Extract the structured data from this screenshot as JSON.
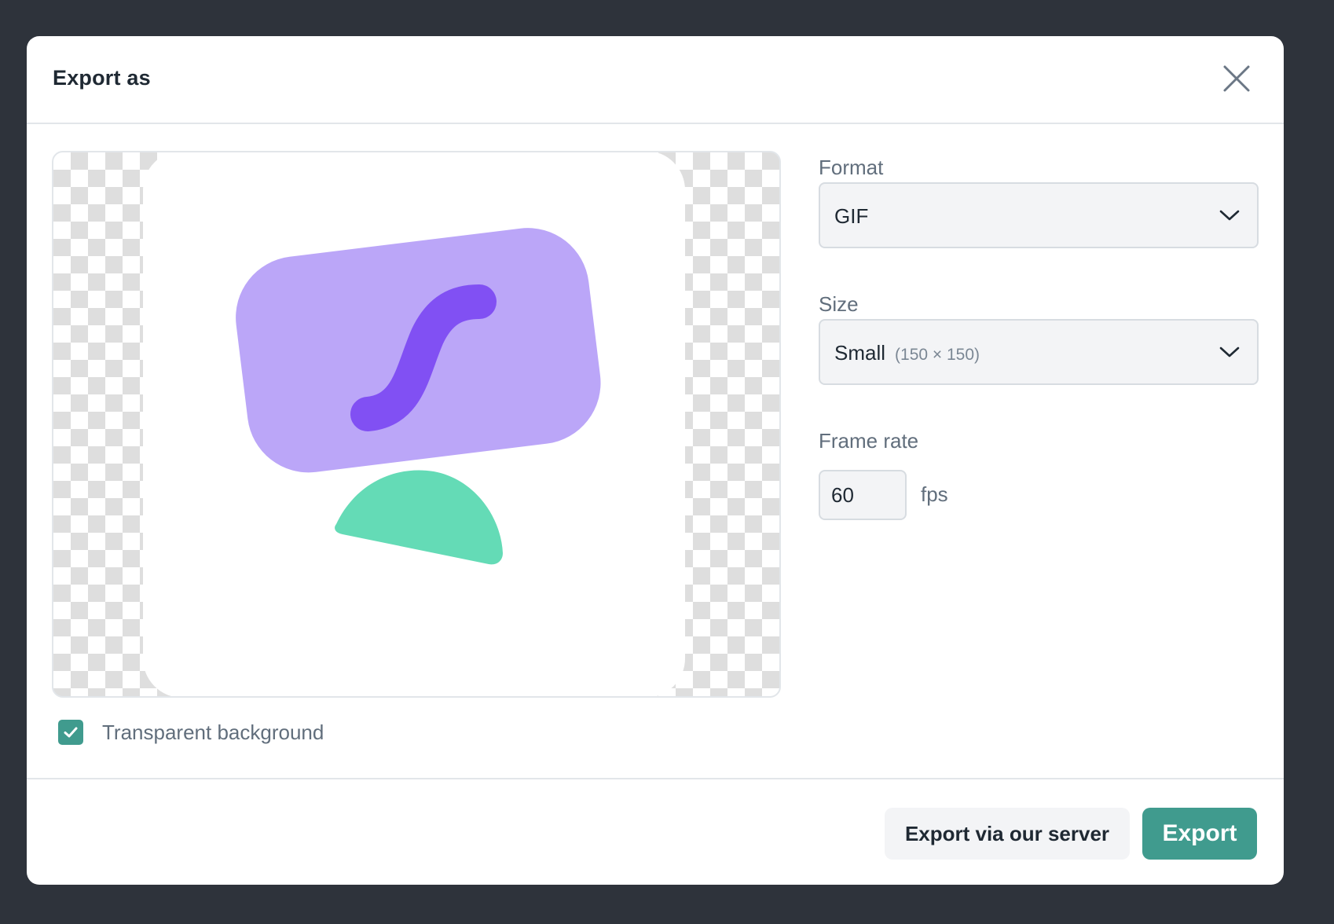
{
  "dialog": {
    "title": "Export as",
    "close_icon": "close-icon"
  },
  "preview": {
    "transparent_background": {
      "label": "Transparent background",
      "checked": true
    },
    "colors": {
      "card": "#bba6f8",
      "squiggle": "#8150f3",
      "semicircle": "#64dbb6"
    }
  },
  "format": {
    "label": "Format",
    "value": "GIF"
  },
  "size": {
    "label": "Size",
    "value": "Small",
    "detail": "(150 × 150)"
  },
  "frame_rate": {
    "label": "Frame rate",
    "value": "60",
    "unit": "fps"
  },
  "footer": {
    "secondary_label": "Export via our server",
    "primary_label": "Export"
  },
  "colors": {
    "accent": "#409b8e",
    "backdrop": "#2e333b"
  }
}
